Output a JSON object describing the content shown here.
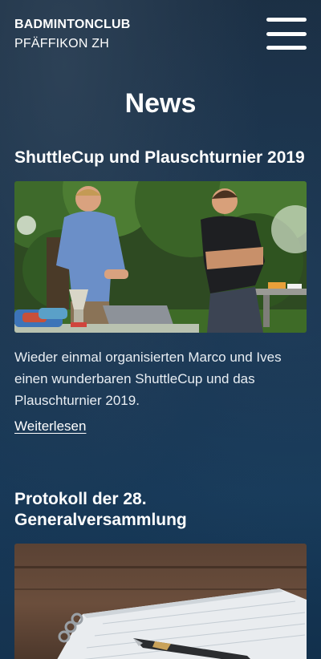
{
  "header": {
    "brand_line1": "BADMINTONCLUB",
    "brand_line2": "PFÄFFIKON ZH",
    "menu_icon": "hamburger-menu-icon"
  },
  "main": {
    "page_title": "News",
    "articles": [
      {
        "title": "ShuttleCup und Plauschturnier 2019",
        "image_alt": "two-men-at-tournament-table-photo",
        "excerpt": "Wieder einmal organisierten Marco und Ives einen wunderbaren ShuttleCup und das Plauschturnier 2019.",
        "read_more": "Weiterlesen"
      },
      {
        "title": "Protokoll der 28. Generalversammlung",
        "image_alt": "fountain-pen-on-notebook-photo"
      }
    ]
  },
  "colors": {
    "background": "#14273a",
    "text": "#ffffff"
  }
}
